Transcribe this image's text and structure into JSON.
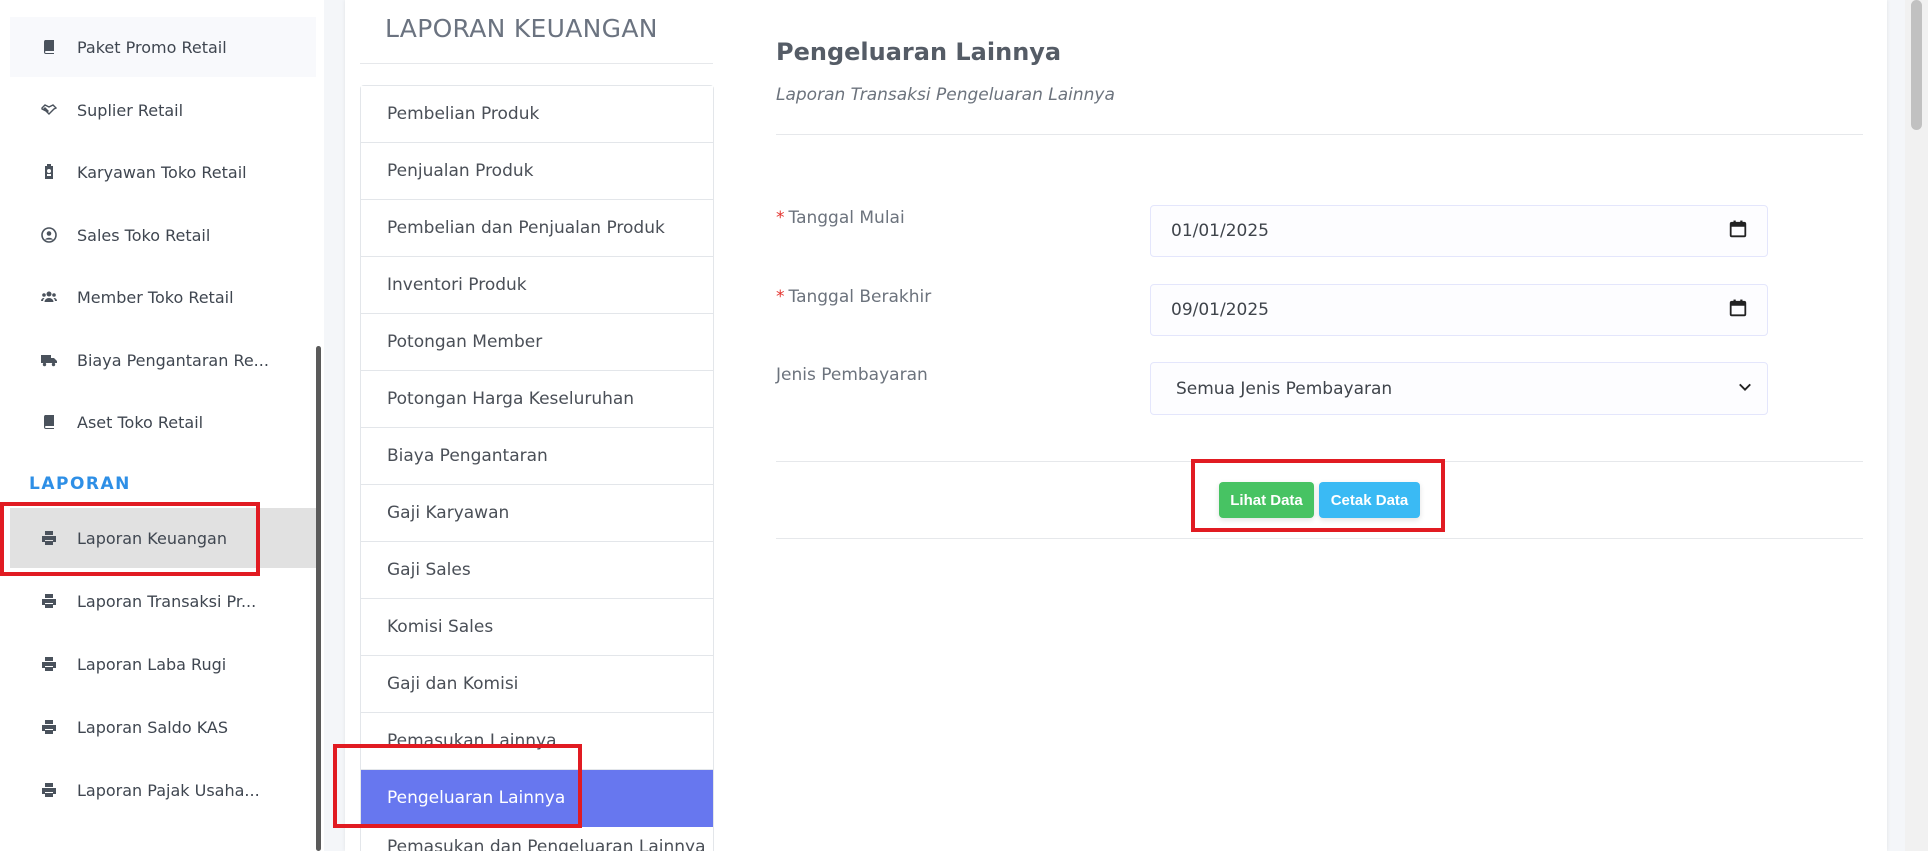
{
  "sidebar": {
    "items": [
      {
        "label": "Paket Promo Retail",
        "icon": "book-icon"
      },
      {
        "label": "Suplier Retail",
        "icon": "handshake-icon"
      },
      {
        "label": "Karyawan Toko Retail",
        "icon": "id-badge-icon"
      },
      {
        "label": "Sales Toko Retail",
        "icon": "user-circle-icon"
      },
      {
        "label": "Member Toko Retail",
        "icon": "users-icon"
      },
      {
        "label": "Biaya Pengantaran Re...",
        "icon": "truck-icon"
      },
      {
        "label": "Aset Toko Retail",
        "icon": "book-icon"
      }
    ],
    "section_label": "LAPORAN",
    "report_items": [
      {
        "label": "Laporan Keuangan",
        "icon": "print-icon",
        "active": true
      },
      {
        "label": "Laporan Transaksi Pr...",
        "icon": "print-icon"
      },
      {
        "label": "Laporan Laba Rugi",
        "icon": "print-icon"
      },
      {
        "label": "Laporan Saldo KAS",
        "icon": "print-icon"
      },
      {
        "label": "Laporan Pajak Usaha...",
        "icon": "print-icon"
      }
    ]
  },
  "report_nav": {
    "title": "LAPORAN KEUANGAN",
    "items": [
      "Pembelian Produk",
      "Penjualan Produk",
      "Pembelian dan Penjualan Produk",
      "Inventori Produk",
      "Potongan Member",
      "Potongan Harga Keseluruhan",
      "Biaya Pengantaran",
      "Gaji Karyawan",
      "Gaji Sales",
      "Komisi Sales",
      "Gaji dan Komisi",
      "Pemasukan Lainnya",
      "Pengeluaran Lainnya",
      "Pemasukan dan Pengeluaran Lainnya"
    ],
    "active_index": 12
  },
  "content": {
    "title": "Pengeluaran Lainnya",
    "subtitle": "Laporan Transaksi Pengeluaran Lainnya",
    "form": {
      "start_date_label": "Tanggal Mulai",
      "start_date_value": "01/01/2025",
      "end_date_label": "Tanggal Berakhir",
      "end_date_value": "09/01/2025",
      "payment_type_label": "Jenis Pembayaran",
      "payment_type_value": "Semua Jenis Pembayaran",
      "required_mark": "*"
    },
    "buttons": {
      "view_label": "Lihat Data",
      "print_label": "Cetak Data"
    }
  },
  "colors": {
    "accent": "#6777ef",
    "section": "#2e8fe6",
    "success": "#47c363",
    "info": "#3abaf4",
    "highlight": "#e11b22"
  }
}
